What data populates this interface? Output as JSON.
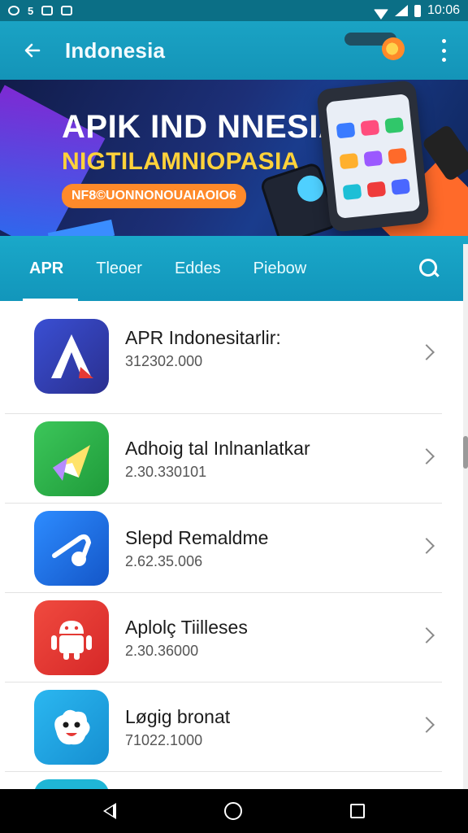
{
  "status_bar": {
    "left_text": "5",
    "time": "10:06",
    "icons": [
      "wifi-icon",
      "signal-icon",
      "battery-icon",
      "notification-icon",
      "image-icon"
    ]
  },
  "app_bar": {
    "title": "Indonesia",
    "back_icon": "arrow-left-icon",
    "menu_icon": "more-vertical-icon"
  },
  "banner": {
    "headline": "APIK IND NNESIA",
    "subheadline": "NIGTILAMNIOPASIA",
    "tag": "NF8©UONNONOUAIAOIO6"
  },
  "tabs": [
    {
      "label": "APR",
      "active": true
    },
    {
      "label": "Tleoer",
      "active": false
    },
    {
      "label": "Eddes",
      "active": false
    },
    {
      "label": "Piebow",
      "active": false
    }
  ],
  "list": [
    {
      "name": "APR Indonesitarlir:",
      "meta": "312302.000",
      "icon": "letter-a-icon",
      "color": "#2f3fa8"
    },
    {
      "name": "Adhoig tal Inlnanlatkar",
      "meta": "2.30.330101",
      "icon": "paper-plane-icon",
      "color": "#34b24a"
    },
    {
      "name": "Slepd Remaldme",
      "meta": "2.62.35.006",
      "icon": "music-note-icon",
      "color": "#1f6fe0"
    },
    {
      "name": "Aplolç Tiilleses",
      "meta": "2.30.36000",
      "icon": "android-icon",
      "color": "#e53935"
    },
    {
      "name": "Løgig bronat",
      "meta": "71022.1000",
      "icon": "face-icon",
      "color": "#1fa7e0"
    }
  ]
}
